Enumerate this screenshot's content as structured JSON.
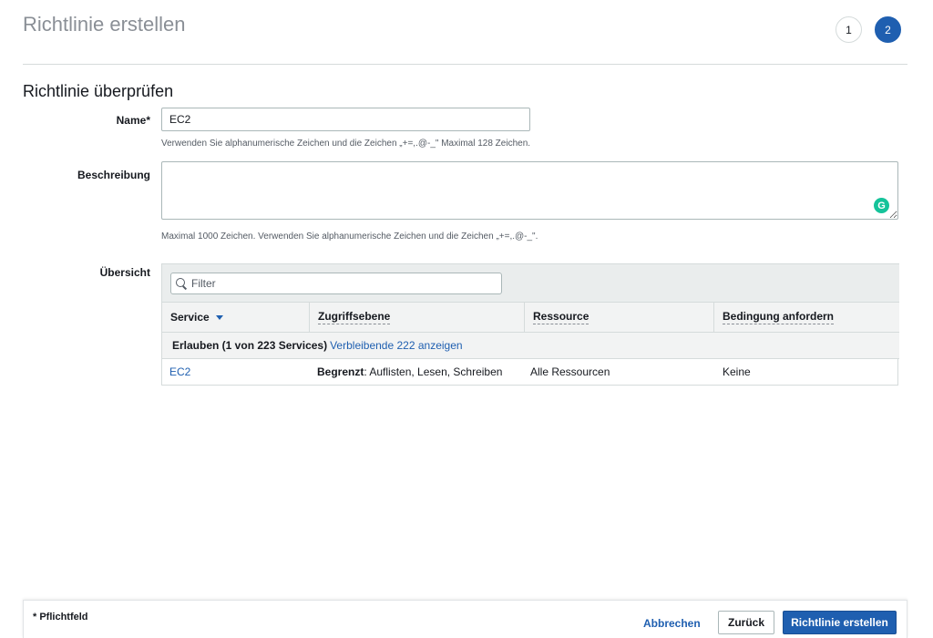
{
  "header": {
    "title": "Richtlinie erstellen",
    "steps": [
      "1",
      "2"
    ],
    "active_step": "2"
  },
  "section": {
    "title": "Richtlinie überprüfen"
  },
  "form": {
    "name_label": "Name*",
    "name_value": "EC2",
    "name_hint": "Verwenden Sie alphanumerische Zeichen und die Zeichen „+=,.@-_\" Maximal 128 Zeichen.",
    "description_label": "Beschreibung",
    "description_value": "",
    "description_hint": "Maximal 1000 Zeichen. Verwenden Sie alphanumerische Zeichen und die Zeichen „+=,.@-_\".",
    "overview_label": "Übersicht"
  },
  "table": {
    "filter_placeholder": "Filter",
    "columns": [
      "Service",
      "Zugriffsebene",
      "Ressource",
      "Bedingung anfordern"
    ],
    "group": {
      "label": "Erlauben (1 von 223 Services)",
      "link": "Verbleibende 222 anzeigen"
    },
    "rows": [
      {
        "service": "EC2",
        "access_bold": "Begrenzt",
        "access_rest": ": Auflisten, Lesen, Schreiben",
        "resource": "Alle Ressourcen",
        "condition": "Keine"
      }
    ]
  },
  "footer": {
    "required_note": "* Pflichtfeld",
    "cancel": "Abbrechen",
    "back": "Zurück",
    "create": "Richtlinie erstellen"
  },
  "colors": {
    "primary": "#1f5fb0",
    "grammarly": "#15c39a"
  },
  "icons": {
    "filter": "search-icon",
    "sort": "sort-down-icon",
    "grammarly": "grammarly-icon"
  }
}
